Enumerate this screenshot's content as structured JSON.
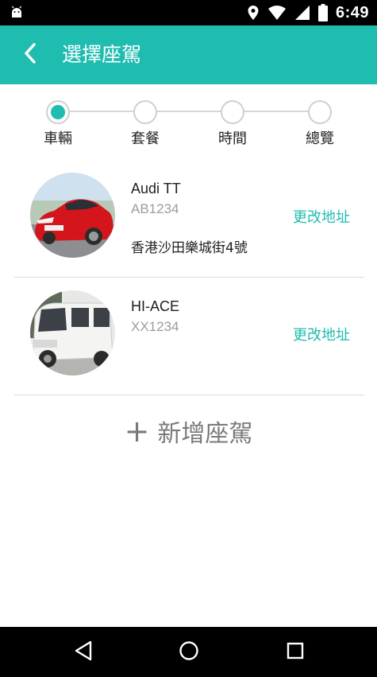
{
  "status_bar": {
    "time": "6:49",
    "icons": [
      "android-icon",
      "location-icon",
      "wifi-icon",
      "signal-icon",
      "battery-icon"
    ]
  },
  "app_bar": {
    "title": "選擇座駕",
    "back_icon": "chevron-left-icon"
  },
  "stepper": {
    "steps": [
      {
        "label": "車輛",
        "active": true
      },
      {
        "label": "套餐",
        "active": false
      },
      {
        "label": "時間",
        "active": false
      },
      {
        "label": "總覽",
        "active": false
      }
    ]
  },
  "vehicles": [
    {
      "name": "Audi TT",
      "plate": "AB1234",
      "address": "香港沙田樂城街4號",
      "change_label": "更改地址",
      "photo": "red-sports-car"
    },
    {
      "name": "HI-ACE",
      "plate": "XX1234",
      "address": "",
      "change_label": "更改地址",
      "photo": "white-van"
    }
  ],
  "add_vehicle": {
    "plus": "+",
    "label": "新增座駕"
  },
  "nav_bar": {
    "icons": [
      "back-triangle-icon",
      "home-circle-icon",
      "recents-square-icon"
    ]
  },
  "colors": {
    "accent": "#1fbcb0",
    "status_bar": "#000000",
    "nav_bar": "#000000"
  }
}
